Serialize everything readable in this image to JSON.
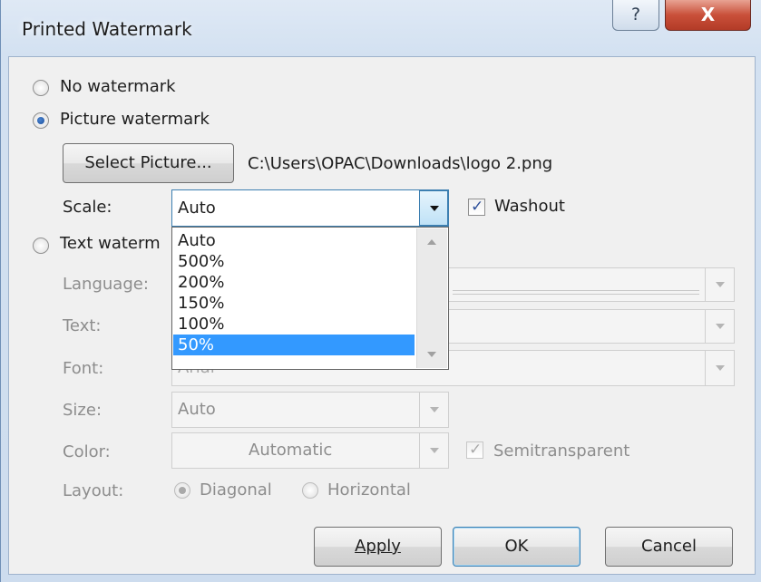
{
  "dialog": {
    "title": "Printed Watermark",
    "help_glyph": "?",
    "close_glyph": "X"
  },
  "options": {
    "no_watermark_label": "No watermark",
    "picture_watermark_label": "Picture watermark",
    "text_watermark_label": "Text waterm",
    "selected": "picture"
  },
  "picture": {
    "select_button_label": "Select Picture...",
    "file_path": "C:\\Users\\OPAC\\Downloads\\logo 2.png",
    "scale_label": "Scale:",
    "scale_value": "Auto",
    "scale_options": [
      "Auto",
      "500%",
      "200%",
      "150%",
      "100%",
      "50%"
    ],
    "highlighted_option": "50%",
    "washout_label": "Washout",
    "washout_checked": true
  },
  "text_watermark": {
    "language_label": "Language:",
    "text_label": "Text:",
    "font_label": "Font:",
    "font_value": "Arial",
    "size_label": "Size:",
    "size_value": "Auto",
    "color_label": "Color:",
    "color_value": "Automatic",
    "semitransparent_label": "Semitransparent",
    "semitransparent_checked": true,
    "layout_label": "Layout:",
    "layout_diagonal_label": "Diagonal",
    "layout_horizontal_label": "Horizontal",
    "layout_selected": "diagonal"
  },
  "buttons": {
    "apply_label": "Apply",
    "ok_label": "OK",
    "cancel_label": "Cancel"
  },
  "colors": {
    "selection": "#3399ff",
    "close_button": "#c9503a",
    "disabled_text": "#8d8d8d"
  },
  "icons": {
    "help": "question-mark-icon",
    "close": "close-x-icon",
    "combo_arrow": "chevron-down-icon",
    "check": "checkmark-icon"
  }
}
